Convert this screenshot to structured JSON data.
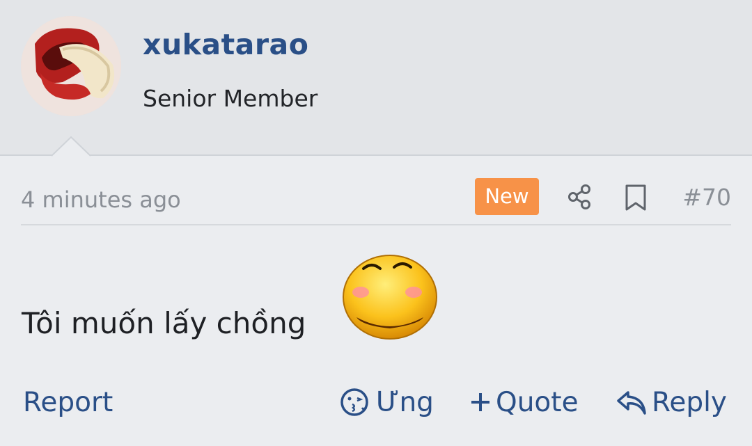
{
  "user": {
    "username": "xukatarao",
    "title": "Senior Member",
    "avatar_icon": "avatar-photo"
  },
  "post": {
    "timestamp": "4 minutes ago",
    "badge": "New",
    "number": "#70",
    "message": "Tôi muốn lấy chồng",
    "emoji_icon": "blushing-smiley-icon"
  },
  "actions": {
    "report": "Report",
    "react": "Ưng",
    "quote": "Quote",
    "reply": "Reply"
  },
  "colors": {
    "link": "#2a4f87",
    "badge": "#f79248",
    "muted": "#8a8f96",
    "header_bg": "#e3e5e8",
    "body_bg": "#ebedf0"
  }
}
